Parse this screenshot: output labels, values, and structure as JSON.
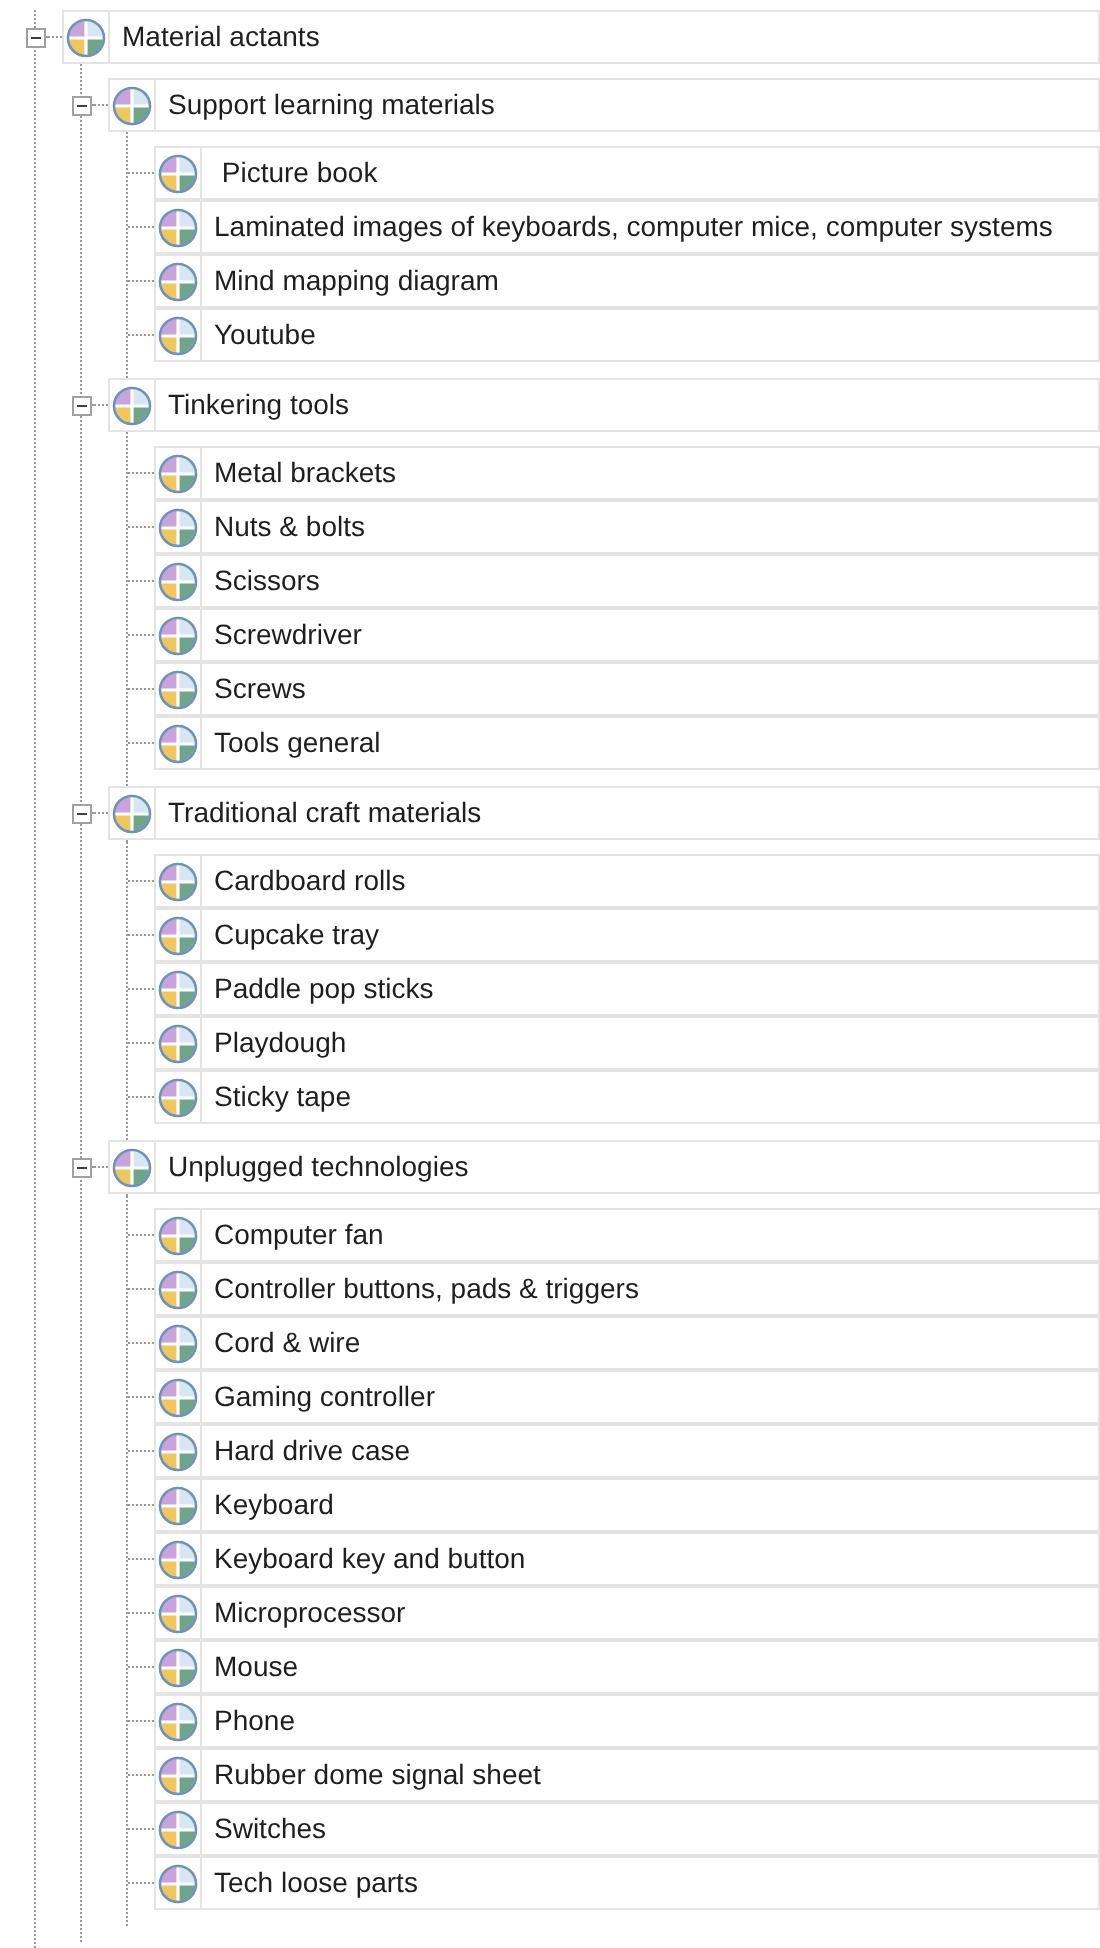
{
  "tree": [
    {
      "label": "Material actants",
      "expanded": true,
      "children": [
        {
          "label": "Support learning materials",
          "expanded": true,
          "children": [
            {
              "label": " Picture book"
            },
            {
              "label": "Laminated images of keyboards, computer mice, computer systems"
            },
            {
              "label": "Mind mapping diagram"
            },
            {
              "label": "Youtube"
            }
          ]
        },
        {
          "label": "Tinkering tools",
          "expanded": true,
          "children": [
            {
              "label": "Metal brackets"
            },
            {
              "label": "Nuts & bolts"
            },
            {
              "label": "Scissors"
            },
            {
              "label": "Screwdriver"
            },
            {
              "label": "Screws"
            },
            {
              "label": "Tools general"
            }
          ]
        },
        {
          "label": "Traditional craft materials",
          "expanded": true,
          "children": [
            {
              "label": "Cardboard rolls"
            },
            {
              "label": "Cupcake tray"
            },
            {
              "label": "Paddle pop sticks"
            },
            {
              "label": "Playdough"
            },
            {
              "label": "Sticky tape"
            }
          ]
        },
        {
          "label": "Unplugged technologies",
          "expanded": true,
          "children": [
            {
              "label": "Computer fan"
            },
            {
              "label": "Controller buttons, pads & triggers"
            },
            {
              "label": "Cord & wire"
            },
            {
              "label": "Gaming controller"
            },
            {
              "label": "Hard drive case"
            },
            {
              "label": "Keyboard"
            },
            {
              "label": "Keyboard key and button"
            },
            {
              "label": "Microprocessor"
            },
            {
              "label": "Mouse"
            },
            {
              "label": "Phone"
            },
            {
              "label": "Rubber dome signal sheet"
            },
            {
              "label": "Switches"
            },
            {
              "label": "Tech loose parts"
            }
          ]
        }
      ]
    }
  ]
}
